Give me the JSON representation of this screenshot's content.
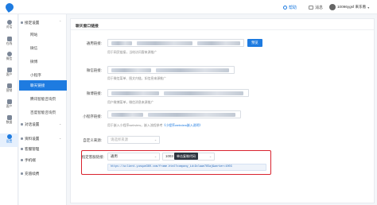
{
  "topbar": {
    "help_label": "帮助",
    "msg_label": "消息",
    "user_name": "10096ygsf 来东看",
    "caret": "▾"
  },
  "rail": [
    {
      "label": "对话",
      "active": false
    },
    {
      "label": "在线",
      "active": false
    },
    {
      "label": "微信",
      "active": false
    },
    {
      "label": "客户",
      "active": false
    },
    {
      "label": "营销",
      "active": false
    },
    {
      "label": "客户",
      "active": false
    },
    {
      "label": "数据",
      "active": false
    },
    {
      "label": "设置",
      "active": true
    }
  ],
  "sidebar": {
    "group1": "接定设置",
    "items": [
      "网站",
      "微信",
      "微博",
      "小程序",
      "聊天链接",
      "腾讯智能咨询页",
      "百度智能咨询页"
    ],
    "group2": "对话设置",
    "group3": "资料设置",
    "group4": "客服管理",
    "group5": "手机端",
    "group6": "充值续费",
    "arrow": "⌄"
  },
  "panel": {
    "title": "聊天窗口链接",
    "rows": {
      "general": {
        "label": "通用链接:",
        "hint": "用于网页链接，当给访问客来源推广",
        "button": "预览"
      },
      "wechat": {
        "label": "微信链接:",
        "hint": "用于微信菜单、图文内链，如信息来源推广"
      },
      "weibo": {
        "label": "微博链接:",
        "hint": "用户微博菜单，微信消息来源推广"
      },
      "miniprogram": {
        "label": "小程序链接:",
        "hint_prefix": "用于嵌入小程序webview，嵌入流程参考",
        "hint_link": "《小程序webview嵌入说明》"
      },
      "custom_source": {
        "label": "自定义来源:",
        "placeholder": "请选择来源",
        "chevron": "⌄"
      },
      "agent_link": {
        "label": "指定客服链接:",
        "select_value": "通用",
        "agent_value": "1003",
        "tooltip": "单击复制代码",
        "chevron": "⌄",
        "url": "https://uclient.yunque360.com/frame.html?company_id=9clawe765aj&worker=1003"
      }
    }
  }
}
